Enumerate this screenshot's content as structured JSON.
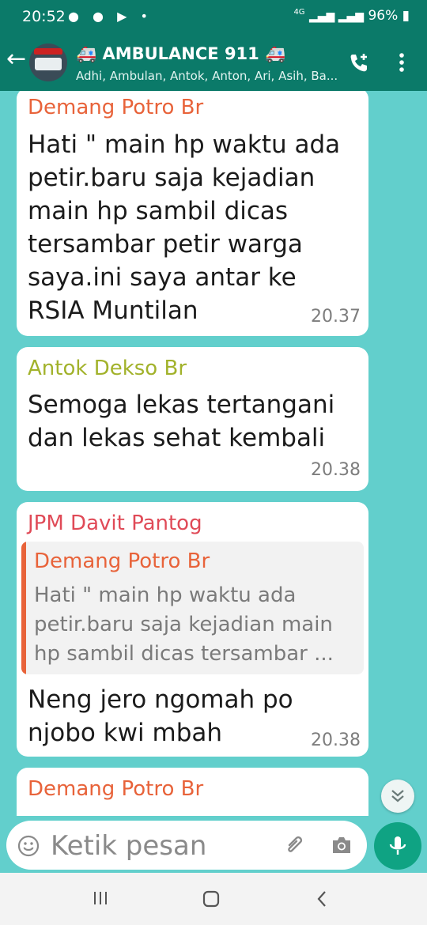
{
  "status": {
    "time": "20:52",
    "left_icons": "● ● ▶ •",
    "network": "4G",
    "battery": "96%"
  },
  "header": {
    "title": "🚑 AMBULANCE 911 🚑",
    "subtitle": "Adhi, Ambulan, Antok, Anton, Ari, Asih, Ba..."
  },
  "messages": [
    {
      "sender": "Demang Potro Br",
      "sender_color": "#e8633a",
      "lines": [
        "Hati \" main hp waktu ada",
        "petir.baru saja kejadian",
        "main hp sambil dicas",
        "tersambar petir warga",
        "saya.ini saya antar ke",
        "RSIA Muntilan"
      ],
      "time": "20.37"
    },
    {
      "sender": "Antok Dekso Br",
      "sender_color": "#a2b22b",
      "lines": [
        "Semoga lekas tertangani",
        "dan lekas sehat kembali"
      ],
      "time": "20.38"
    },
    {
      "sender": "JPM Davit Pantog",
      "sender_color": "#e04a57",
      "quote": {
        "sender": "Demang Potro Br",
        "lines": [
          "Hati \" main hp waktu ada",
          "petir.baru saja kejadian main",
          "hp sambil dicas tersambar ..."
        ]
      },
      "lines": [
        "Neng jero ngomah po",
        "njobo kwi mbah"
      ],
      "time": "20.38"
    },
    {
      "sender": "Demang Potro Br",
      "sender_color": "#e8633a"
    }
  ],
  "input": {
    "placeholder": "Ketik pesan"
  },
  "colors": {
    "app_bar": "#0b7a69",
    "chat_bg": "#62cfcc",
    "send_button": "#0fa383"
  }
}
